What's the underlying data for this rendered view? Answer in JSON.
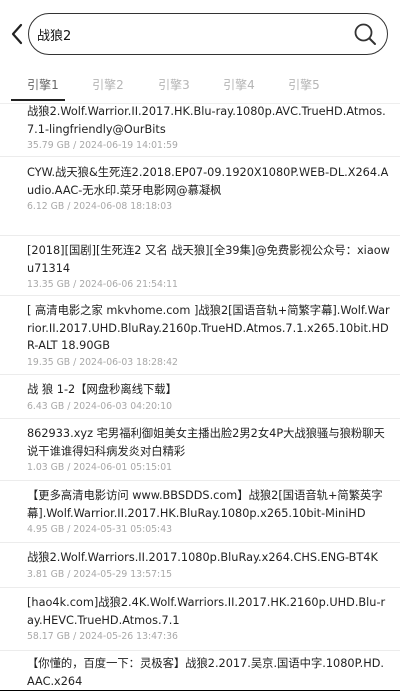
{
  "search": {
    "query": "战狼2"
  },
  "tabs": [
    {
      "label": "引擎1"
    },
    {
      "label": "引擎2"
    },
    {
      "label": "引擎3"
    },
    {
      "label": "引擎4"
    },
    {
      "label": "引擎5"
    }
  ],
  "results": [
    {
      "title": "战狼2.Wolf.Warrior.II.2017.HK.Blu-ray.1080p.AVC.TrueHD.Atmos.7.1-lingfriendly@OurBits",
      "meta": "35.79 GB / 2024-06-19 14:01:59"
    },
    {
      "title": "CYW.战天狼&生死连2.2018.EP07-09.1920X1080P.WEB-DL.X264.Audio.AAC-无水印.菜牙电影网@慕凝枫",
      "meta": "6.12 GB / 2024-06-08 18:18:03"
    },
    {
      "title": "[2018][国剧][生死连2 又名 战天狼][全39集]@免费影视公众号：xiaowu71314",
      "meta": "13.35 GB / 2024-06-06 21:54:11"
    },
    {
      "title": "[ 高清电影之家 mkvhome.com ]战狼2[国语音轨+简繁字幕].Wolf.Warrior.II.2017.UHD.BluRay.2160p.TrueHD.Atmos.7.1.x265.10bit.HDR-ALT 18.90GB",
      "meta": "19.35 GB / 2024-06-03 18:28:42"
    },
    {
      "title": "战 狼 1-2【网盘秒离线下载】",
      "meta": "6.43 GB / 2024-06-03 04:20:10"
    },
    {
      "title": "862933.xyz 宅男福利御姐美女主播出脸2男2女4P大战狼骚与狼粉聊天说干谁谁得妇科病发炎对白精彩",
      "meta": "1.03 GB / 2024-06-01 05:15:01"
    },
    {
      "title": "【更多高清电影访问 www.BBSDDS.com】战狼2[国语音轨+简繁英字幕].Wolf.Warrior.II.2017.HK.BluRay.1080p.x265.10bit-MiniHD",
      "meta": "4.95 GB / 2024-05-31 05:05:43"
    },
    {
      "title": "战狼2.Wolf.Warriors.II.2017.1080p.BluRay.x264.CHS.ENG-BT4K",
      "meta": "3.81 GB / 2024-05-29 13:57:15"
    },
    {
      "title": "[hao4k.com]战狼2.4K.Wolf.Warriors.II.2017.HK.2160p.UHD.Blu-ray.HEVC.TrueHD.Atmos.7.1",
      "meta": "58.17 GB / 2024-05-26 13:47:36"
    },
    {
      "title": "【你懂的，百度一下：灵极客】战狼2.2017.吴京.国语中字.1080P.HD.AAC.x264",
      "meta": ""
    }
  ]
}
